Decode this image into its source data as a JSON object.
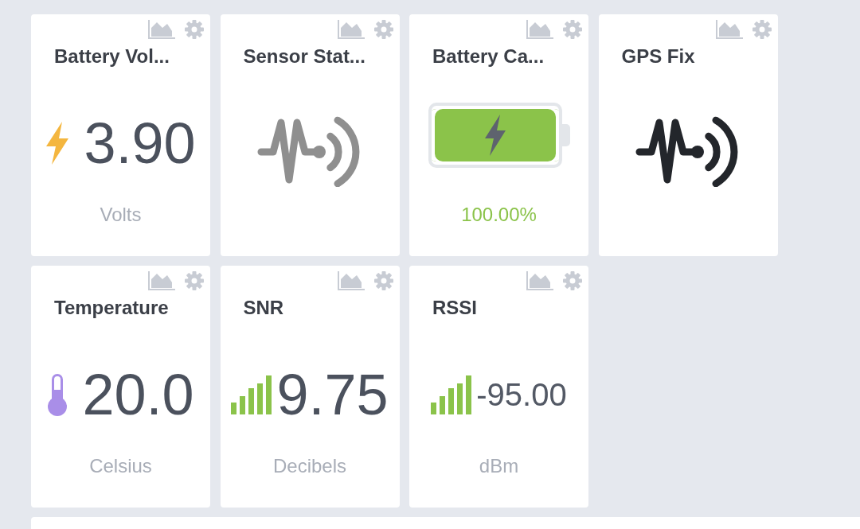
{
  "widgets": [
    {
      "kind": "voltage",
      "title": "Battery Vol...",
      "value": "3.90",
      "unit": "Volts"
    },
    {
      "kind": "status",
      "title": "Sensor Stat...",
      "on": false
    },
    {
      "kind": "battery",
      "title": "Battery Ca...",
      "level": 1,
      "charging": true,
      "reading": "100.00%"
    },
    {
      "kind": "status",
      "title": "GPS Fix",
      "on": true
    },
    {
      "kind": "temperature",
      "title": "Temperature",
      "value": "20.0",
      "unit": "Celsius"
    },
    {
      "kind": "signal",
      "title": "SNR",
      "value": "9.75",
      "unit": "Decibels"
    },
    {
      "kind": "signal",
      "title": "RSSI",
      "value": "-95.00",
      "unit": "dBm"
    }
  ]
}
